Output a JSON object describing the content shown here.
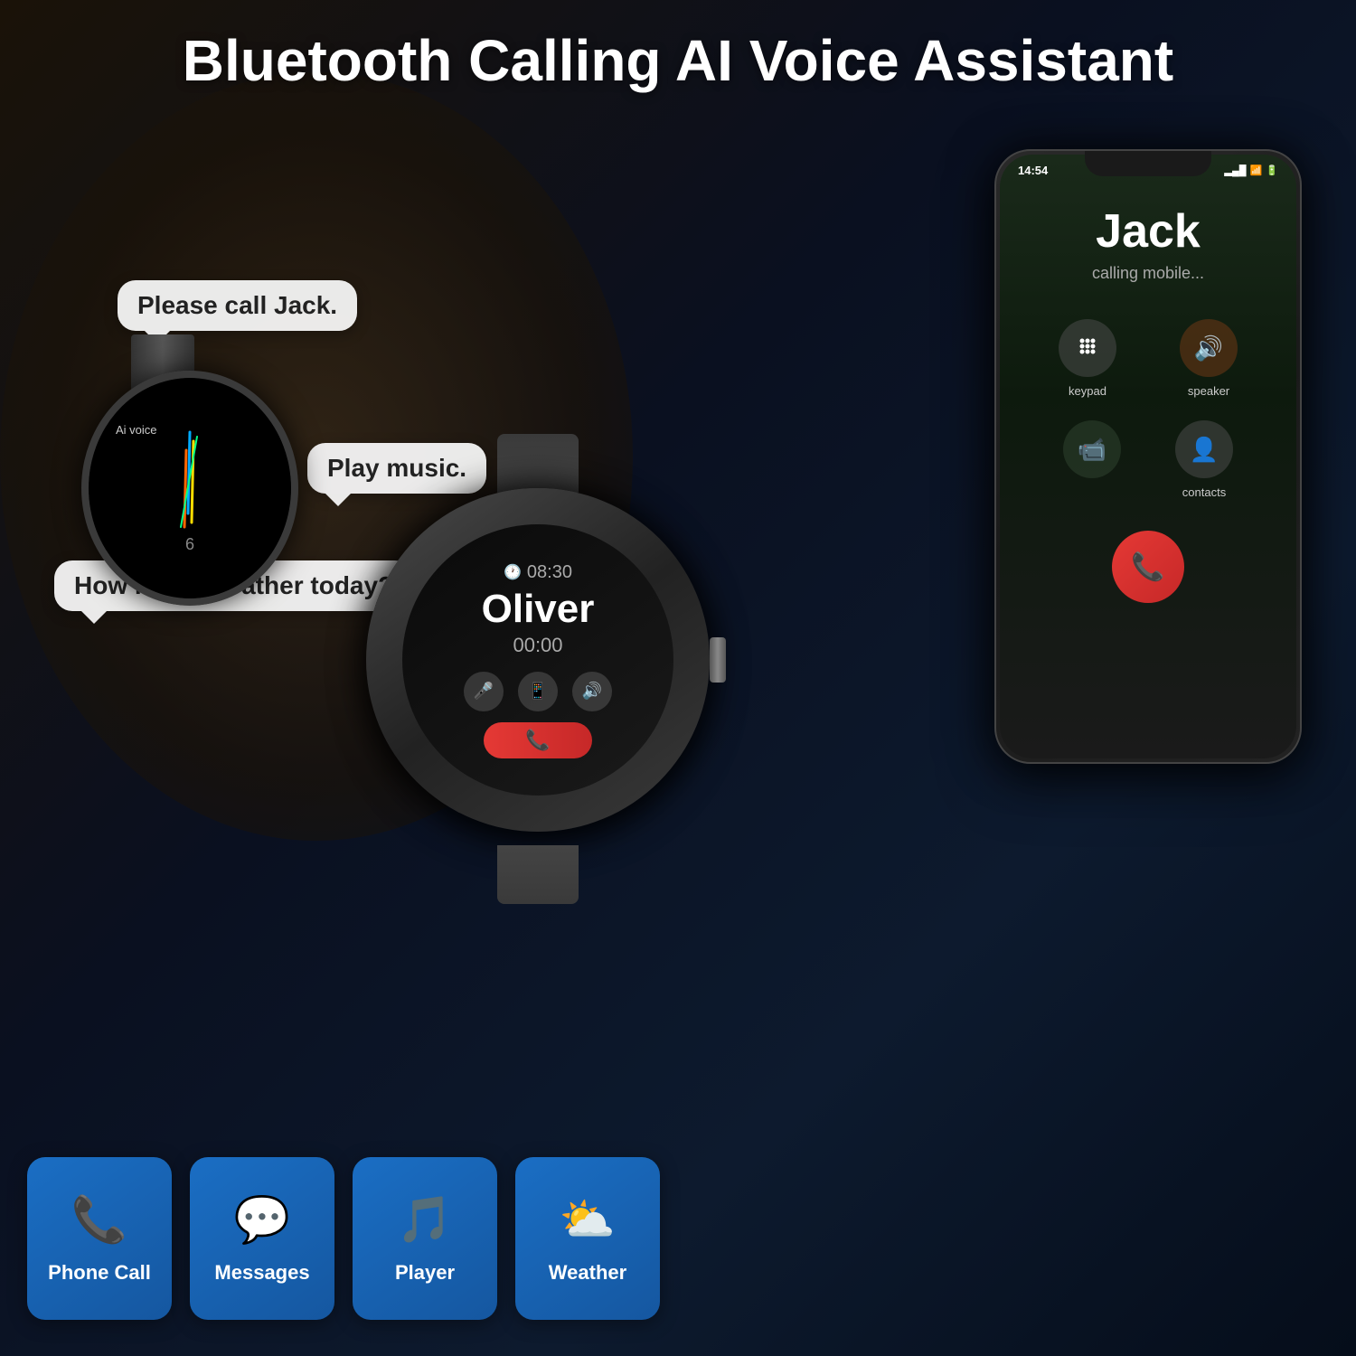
{
  "title": "Bluetooth Calling AI Voice Assistant",
  "bubbles": {
    "call": "Please call Jack.",
    "music": "Play music.",
    "weather": "How is the weather today?"
  },
  "watch_small": {
    "ai_label": "Ai voice",
    "number": "6"
  },
  "watch_large": {
    "time": "08:30",
    "name": "Oliver",
    "duration": "00:00"
  },
  "phone": {
    "status_time": "14:54",
    "caller_name": "Jack",
    "caller_status": "calling mobile...",
    "keypad_label": "keypad",
    "speaker_label": "speaker",
    "contacts_label": "contacts"
  },
  "features": [
    {
      "id": "phone-call",
      "label": "Phone Call",
      "icon": "📞"
    },
    {
      "id": "messages",
      "label": "Messages",
      "icon": "💬"
    },
    {
      "id": "player",
      "label": "Player",
      "icon": "🎵"
    },
    {
      "id": "weather",
      "label": "Weather",
      "icon": "⛅"
    }
  ]
}
